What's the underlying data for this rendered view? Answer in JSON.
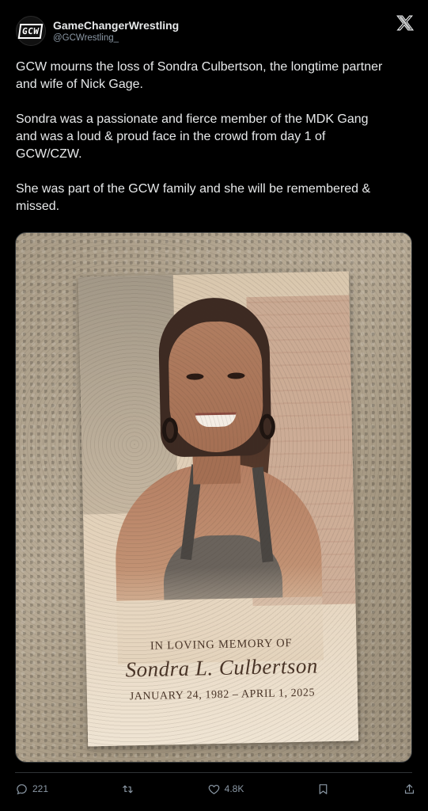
{
  "account": {
    "display_name": "GameChangerWrestling",
    "handle": "@GCWrestling_",
    "avatar_text": "GCW"
  },
  "post": {
    "paragraphs": [
      "GCW mourns the loss of Sondra Culbertson, the longtime partner\nand wife of Nick Gage.",
      "Sondra was a passionate and fierce member of the MDK Gang\nand was a loud & proud face in the crowd from day 1 of\nGCW/CZW.",
      "She was part of the GCW family and she will be remembered &\nmissed."
    ]
  },
  "memorial_card": {
    "title": "IN LOVING MEMORY OF",
    "name": "Sondra L. Culbertson",
    "dates": "JANUARY 24, 1982 – APRIL 1, 2025"
  },
  "actions": {
    "replies": "221",
    "likes": "4.8K"
  },
  "icons": {
    "close": "x-logo-icon",
    "reply": "reply-icon",
    "repost": "repost-icon",
    "like": "heart-icon",
    "bookmark": "bookmark-icon",
    "share": "share-icon"
  }
}
